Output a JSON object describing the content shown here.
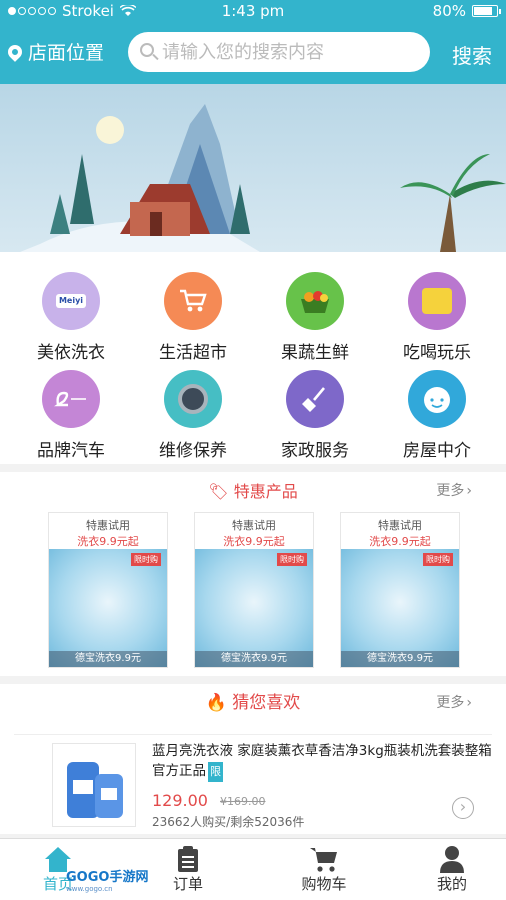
{
  "status_bar": {
    "carrier": "Strokei",
    "time": "1:43 pm",
    "battery": "80%"
  },
  "header": {
    "location": "店面位置",
    "search_placeholder": "请输入您的搜索内容",
    "search_button": "搜索"
  },
  "categories": [
    {
      "label": "美依洗衣",
      "icon": "meiyi-logo-icon",
      "color": "#c8b2ea"
    },
    {
      "label": "生活超市",
      "icon": "shopping-cart-icon",
      "color": "#f58a55"
    },
    {
      "label": "果蔬生鲜",
      "icon": "fruit-basket-icon",
      "color": "#67c24a"
    },
    {
      "label": "吃喝玩乐",
      "icon": "food-fun-icon",
      "color": "#b977cf"
    },
    {
      "label": "品牌汽车",
      "icon": "second-hand-car-icon",
      "color": "#c486d6"
    },
    {
      "label": "维修保养",
      "icon": "repair-tools-icon",
      "color": "#46bec4"
    },
    {
      "label": "家政服务",
      "icon": "broom-icon",
      "color": "#7e68c9"
    },
    {
      "label": "房屋中介",
      "icon": "agent-face-icon",
      "color": "#31a8da"
    }
  ],
  "specials": {
    "title": "特惠产品",
    "more": "更多",
    "products": [
      {
        "line1": "特惠试用",
        "line2": "洗衣9.9元起",
        "tag": "限时购",
        "caption": "德宝洗衣9.9元"
      },
      {
        "line1": "特惠试用",
        "line2": "洗衣9.9元起",
        "tag": "限时购",
        "caption": "德宝洗衣9.9元"
      },
      {
        "line1": "特惠试用",
        "line2": "洗衣9.9元起",
        "tag": "限时购",
        "caption": "德宝洗衣9.9元"
      }
    ]
  },
  "recommend": {
    "title": "猜您喜欢",
    "more": "更多",
    "item": {
      "name": "蓝月亮洗衣液 家庭装薰衣草香洁净3kg瓶装机洗套装整箱官方正品",
      "badge": "限",
      "price": "129.00",
      "old_price": "¥169.00",
      "sold": "23662人购买/剩余52036件"
    }
  },
  "tabbar": {
    "tabs": [
      "首页",
      "订单",
      "购物车",
      "我的"
    ],
    "active": 0
  },
  "watermark": {
    "brand": "GOGO手游网",
    "url": "www.gogo.cn"
  },
  "colors": {
    "primary": "#33b4cc",
    "accent": "#e24a4a"
  }
}
